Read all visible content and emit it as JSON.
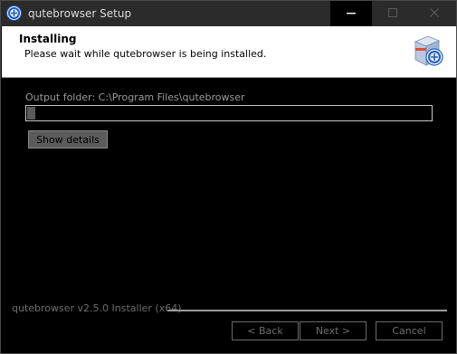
{
  "window": {
    "title": "qutebrowser Setup",
    "icons": {
      "app": "qutebrowser-logo-icon",
      "minimize": "minimize-icon",
      "maximize": "maximize-icon",
      "close": "close-icon"
    }
  },
  "header": {
    "title": "Installing",
    "subtitle": "Please wait while qutebrowser is being installed.",
    "logo": "installer-box-icon"
  },
  "main": {
    "output_folder": "Output folder: C:\\Program Files\\qutebrowser",
    "progress": 0.02,
    "show_details_label": "Show details"
  },
  "footer": {
    "brand_text": "qutebrowser v2.5.0 Installer (x64)",
    "back_label": "< Back",
    "next_label": "Next >",
    "cancel_label": "Cancel"
  },
  "colors": {
    "titlebar": "#2b2b2b",
    "header_bg": "#ffffff",
    "body_bg": "#000000",
    "progress_fill": "#5a5a5a",
    "logo_blue": "#1f5fbf"
  }
}
